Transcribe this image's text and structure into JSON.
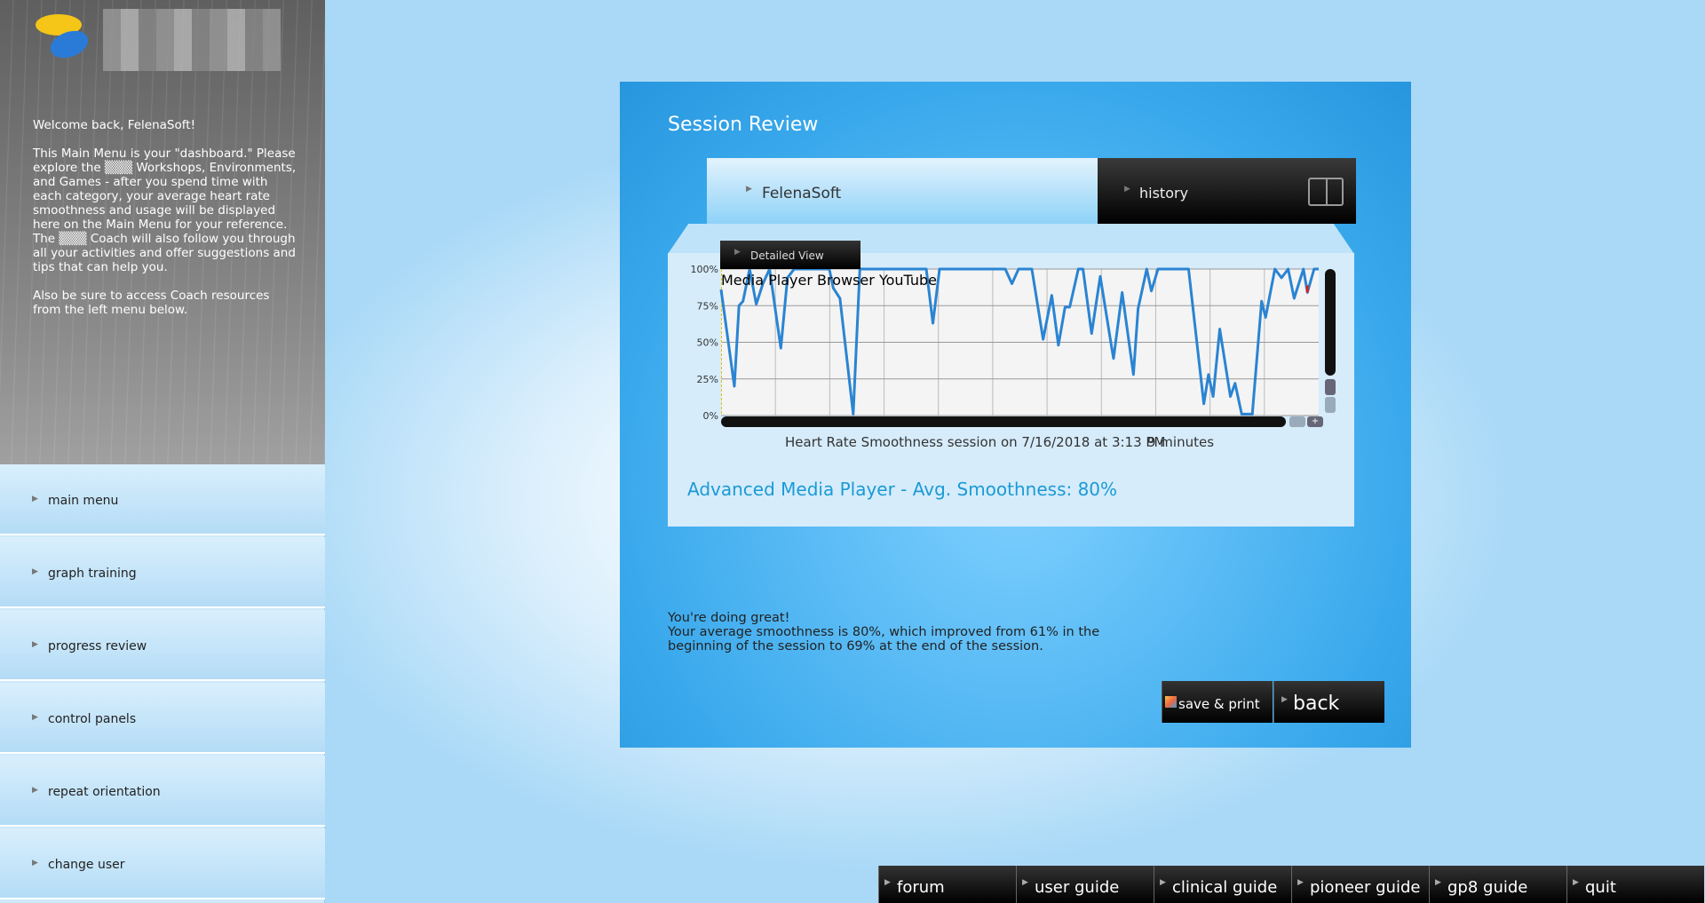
{
  "sidebar": {
    "welcome": "Welcome back, FelenaSoft!\n\nThis Main Menu is your \"dashboard.\" Please explore the ▒▒▒ Workshops, Environments, and Games - after you spend time with each category, your average heart rate smoothness and usage will be displayed here on the Main Menu for your reference. The ▒▒▒ Coach will also follow you through all your activities and offer suggestions and tips that can help you.\n\nAlso be sure to access Coach resources from the left menu below.",
    "items": [
      {
        "label": "main menu"
      },
      {
        "label": "graph training"
      },
      {
        "label": "progress review"
      },
      {
        "label": "control panels"
      },
      {
        "label": "repeat orientation"
      },
      {
        "label": "change user"
      }
    ]
  },
  "panel": {
    "title": "Session Review",
    "tabs": {
      "user": "FelenaSoft",
      "history": "history"
    },
    "detailed_view": "Detailed View",
    "caption": "Heart Rate Smoothness session on 7/16/2018 at 3:13 PM",
    "duration": "9 minutes",
    "avg": "Advanced Media Player - Avg. Smoothness: 80%",
    "feedback": "You're doing great!\nYour average smoothness is 80%, which improved from 61% in the\nbeginning of the session to 69% at the end of the session.",
    "save_label": "save & print",
    "back_label": "back"
  },
  "chart_data": {
    "type": "line",
    "title": "Media Player Browser YouTube",
    "xlabel": "",
    "ylabel": "",
    "xlim": [
      0,
      9
    ],
    "ylim": [
      0,
      100
    ],
    "yticks": [
      "0%",
      "25%",
      "50%",
      "75%",
      "100%"
    ],
    "grid": true,
    "color": "#2a84d2",
    "end_marker_color": "#e02020",
    "x": [
      0,
      0.2,
      0.27,
      0.33,
      0.43,
      0.53,
      0.63,
      0.73,
      0.9,
      1.0,
      1.1,
      1.63,
      1.69,
      1.79,
      1.99,
      2.09,
      3.09,
      3.19,
      3.29,
      4.28,
      4.38,
      4.48,
      4.68,
      4.85,
      4.98,
      5.08,
      5.18,
      5.25,
      5.38,
      5.45,
      5.58,
      5.71,
      5.88,
      5.91,
      6.04,
      6.21,
      6.28,
      6.41,
      6.48,
      6.58,
      7.04,
      7.27,
      7.34,
      7.41,
      7.51,
      7.67,
      7.74,
      7.84,
      8.0,
      8.14,
      8.2,
      8.34,
      8.44,
      8.54,
      8.63,
      8.77,
      8.83,
      8.93,
      9.0
    ],
    "y": [
      86,
      20,
      75,
      78,
      100,
      76,
      90,
      100,
      46,
      94,
      100,
      100,
      87,
      80,
      1,
      100,
      100,
      63,
      100,
      100,
      90,
      100,
      100,
      52,
      82,
      48,
      74,
      74,
      100,
      100,
      56,
      95,
      47,
      39,
      84,
      28,
      73,
      100,
      85,
      100,
      100,
      8,
      28,
      13,
      59,
      13,
      22,
      1,
      1,
      78,
      67,
      100,
      94,
      100,
      80,
      100,
      84,
      100,
      100
    ]
  },
  "bottom_bar": [
    {
      "label": "forum"
    },
    {
      "label": "user guide"
    },
    {
      "label": "clinical guide"
    },
    {
      "label": "pioneer guide"
    },
    {
      "label": "gp8 guide"
    },
    {
      "label": "quit"
    }
  ]
}
